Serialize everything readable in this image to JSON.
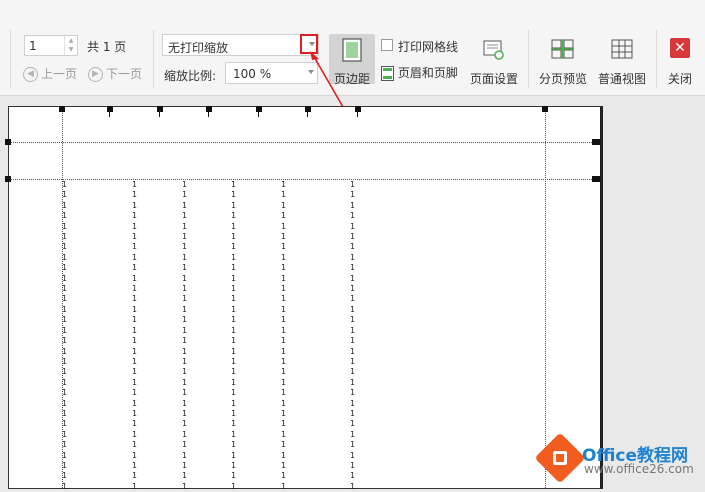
{
  "toolbar": {
    "page_input_value": "1",
    "page_total": "共 1 页",
    "prev_page": "上一页",
    "next_page": "下一页",
    "scaling_mode": "无打印缩放",
    "zoom_label": "缩放比例:",
    "zoom_value": "100 %",
    "margins_label": "页边距",
    "print_gridlines_label": "打印网格线",
    "print_gridlines_checked": false,
    "header_footer_label": "页眉和页脚",
    "page_setup_label": "页面设置",
    "page_break_preview_label": "分页预览",
    "normal_view_label": "普通视图",
    "close_label": "关闭"
  },
  "preview": {
    "cell_value": "1",
    "column_marks": [
      "1",
      "1",
      "1",
      "1",
      "1",
      "1"
    ]
  },
  "watermark": {
    "brand": "Office教程网",
    "url": "www.office26.com"
  },
  "colors": {
    "annotation_red": "#e02020",
    "close_red": "#d9383a",
    "brand_orange": "#f25c1f",
    "brand_blue": "#1e82d2"
  }
}
